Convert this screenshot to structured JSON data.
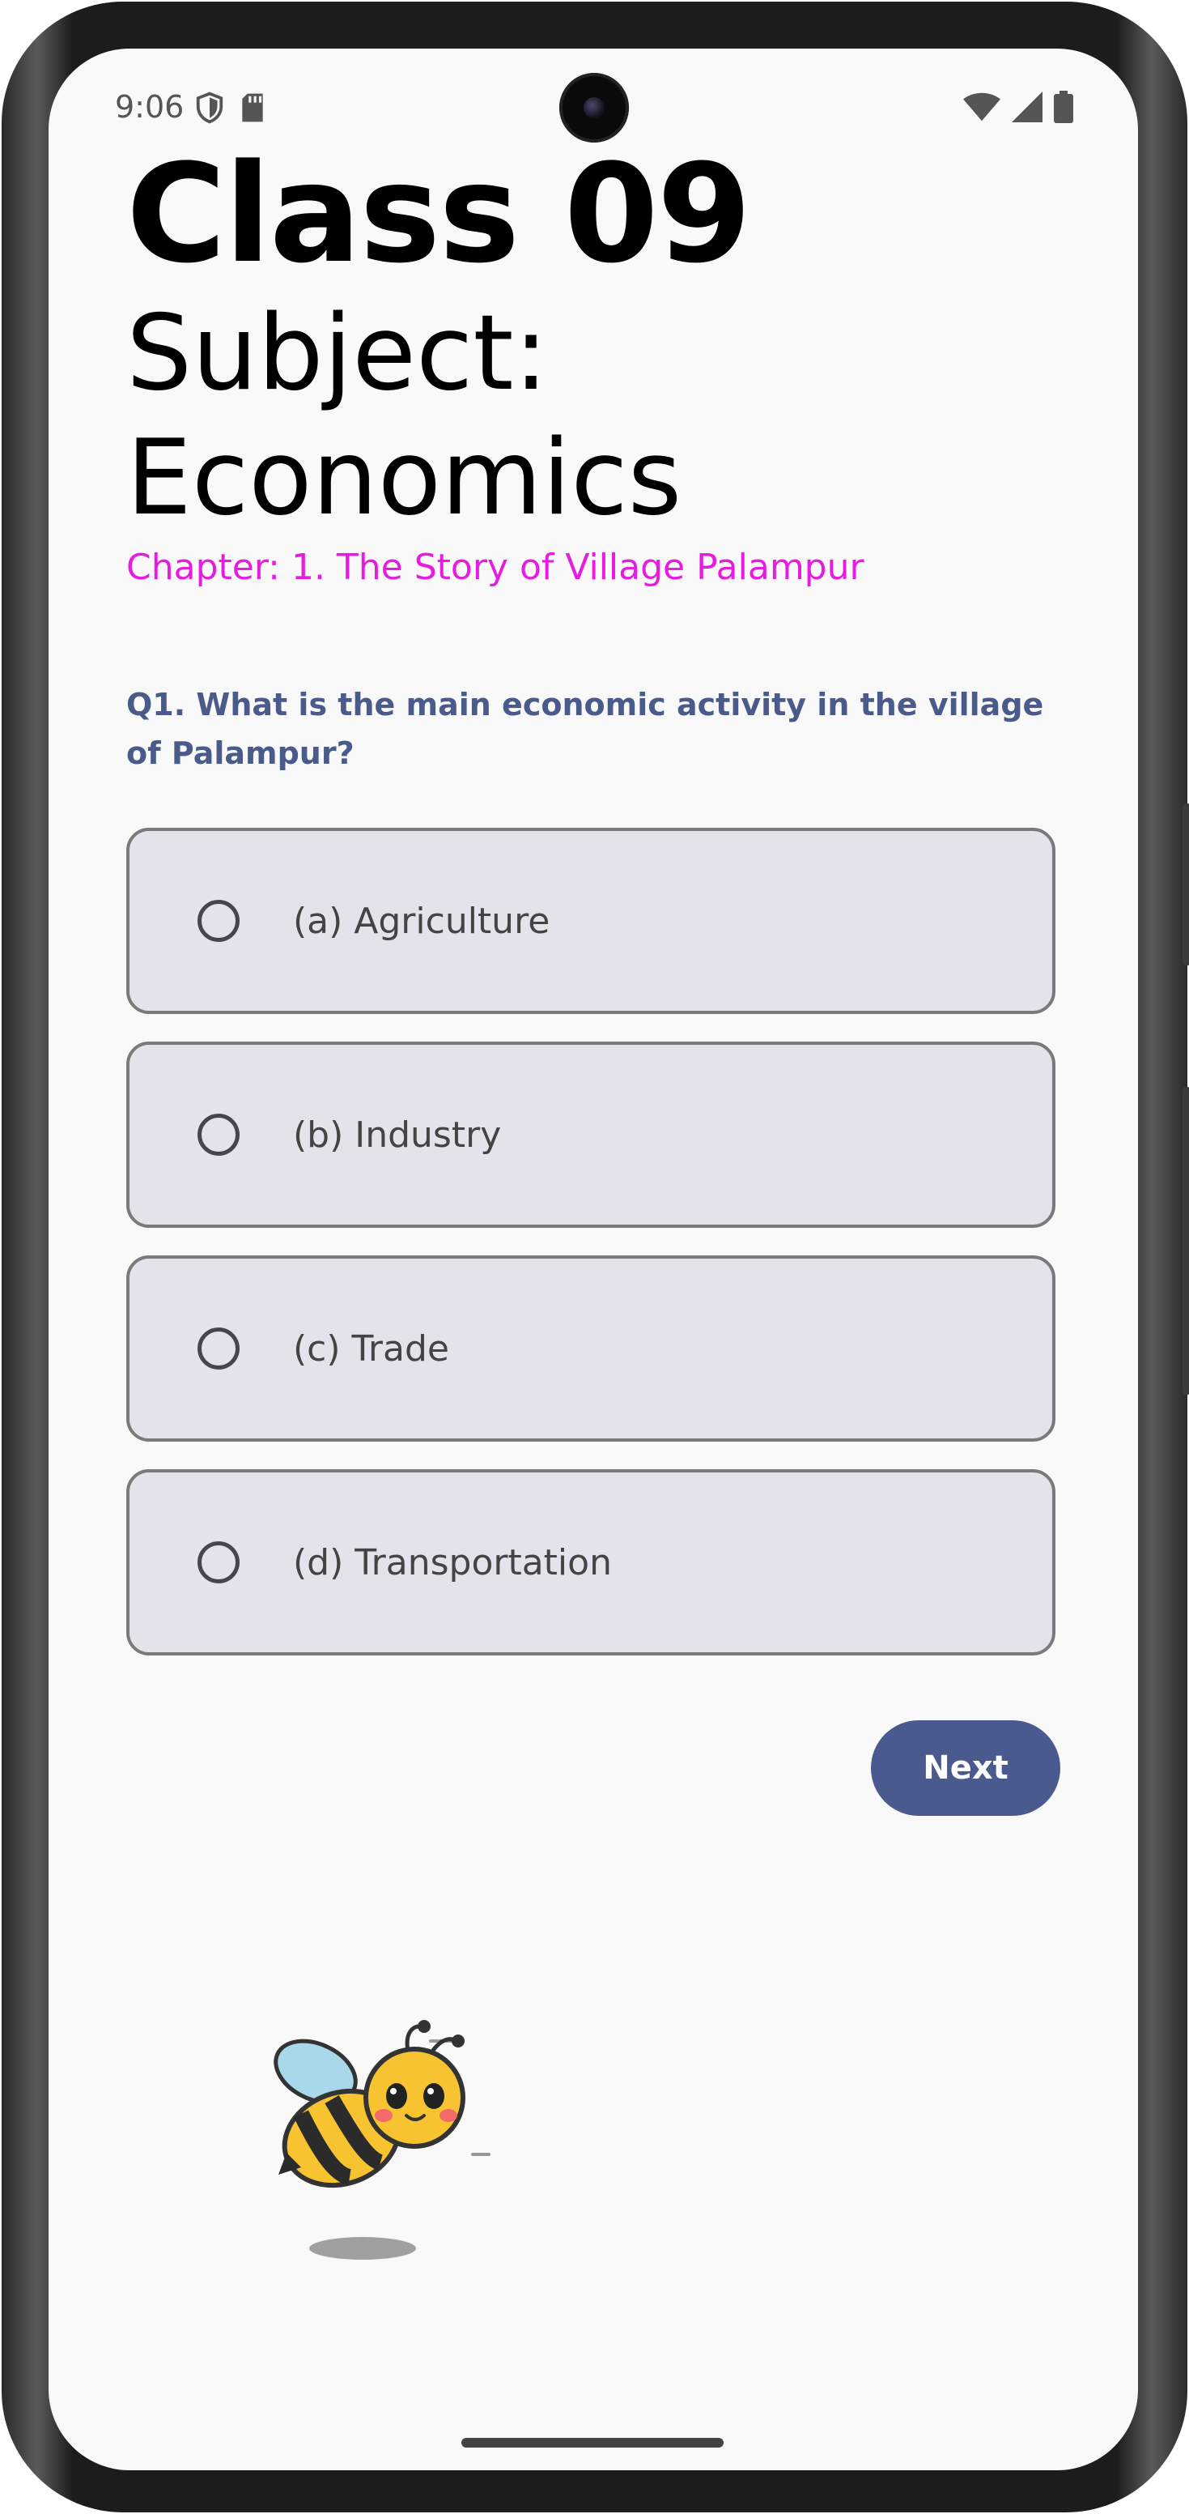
{
  "status_bar": {
    "time": "9:06",
    "left_icons": [
      "shield-icon",
      "sd-card-icon"
    ],
    "right_icons": [
      "wifi-icon",
      "cellular-signal-icon",
      "battery-icon"
    ]
  },
  "header": {
    "class_title": "Class 09",
    "subject": "Subject: Economics",
    "chapter": "Chapter: 1. The Story of Village Palampur"
  },
  "quiz": {
    "question": "Q1. What is the main economic activity in the village of Palampur?",
    "options": [
      {
        "label": "(a) Agriculture"
      },
      {
        "label": "(b) Industry"
      },
      {
        "label": "(c) Trade"
      },
      {
        "label": "(d) Transportation"
      }
    ],
    "next_label": "Next"
  },
  "colors": {
    "chapter": "#e61de0",
    "question": "#4a5a8a",
    "option_bg": "#e3e3ec",
    "next_button": "#4a5a8e"
  },
  "illustration": "bee-mascot"
}
